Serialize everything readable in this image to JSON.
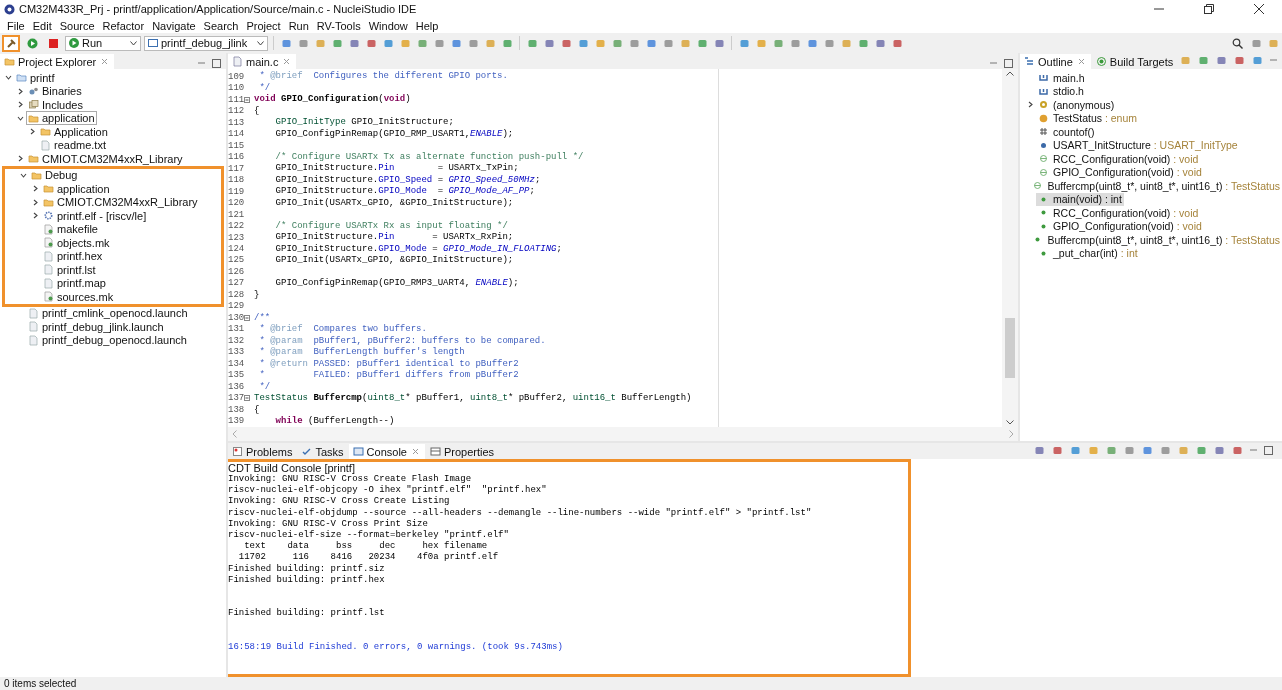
{
  "window": {
    "title": "CM32M433R_Prj - printf/application/Application/Source/main.c - NucleiStudio IDE"
  },
  "menu": [
    "File",
    "Edit",
    "Source",
    "Refactor",
    "Navigate",
    "Search",
    "Project",
    "Run",
    "RV-Tools",
    "Window",
    "Help"
  ],
  "toolbar": {
    "build_highlighted": true,
    "run_mode": "Run",
    "launch_config": "printf_debug_jlink"
  },
  "project_explorer": {
    "title": "Project Explorer",
    "tree": [
      {
        "label": "printf",
        "kind": "project",
        "expanded": true,
        "selected": false,
        "children": [
          {
            "label": "Binaries",
            "kind": "binaries",
            "expanded": false,
            "selected": false
          },
          {
            "label": "Includes",
            "kind": "includes",
            "expanded": false,
            "selected": false
          },
          {
            "label": "application",
            "kind": "folder",
            "expanded": true,
            "selected": true,
            "children": [
              {
                "label": "Application",
                "kind": "folder",
                "expanded": false,
                "selected": false
              },
              {
                "label": "readme.txt",
                "kind": "file",
                "selected": false
              }
            ]
          },
          {
            "label": "CMIOT.CM32M4xxR_Library",
            "kind": "folder",
            "expanded": false,
            "selected": false
          },
          {
            "label": "Debug",
            "kind": "folder",
            "expanded": true,
            "selected": false,
            "highlighted": true,
            "children": [
              {
                "label": "application",
                "kind": "folder",
                "expanded": false,
                "selected": false
              },
              {
                "label": "CMIOT.CM32M4xxR_Library",
                "kind": "folder",
                "expanded": false,
                "selected": false
              },
              {
                "label": "printf.elf - [riscv/le]",
                "kind": "elf",
                "expanded": false,
                "selected": false
              },
              {
                "label": "makefile",
                "kind": "makefile",
                "selected": false
              },
              {
                "label": "objects.mk",
                "kind": "makefile",
                "selected": false
              },
              {
                "label": "printf.hex",
                "kind": "file",
                "selected": false
              },
              {
                "label": "printf.lst",
                "kind": "file",
                "selected": false
              },
              {
                "label": "printf.map",
                "kind": "file",
                "selected": false
              },
              {
                "label": "sources.mk",
                "kind": "makefile",
                "selected": false
              }
            ]
          },
          {
            "label": "printf_cmlink_openocd.launch",
            "kind": "file",
            "selected": false
          },
          {
            "label": "printf_debug_jlink.launch",
            "kind": "file",
            "selected": false
          },
          {
            "label": "printf_debug_openocd.launch",
            "kind": "file",
            "selected": false
          }
        ]
      }
    ]
  },
  "editor": {
    "tab": "main.c",
    "lines": [
      {
        "no": "109",
        "tokens": [
          {
            "t": " * ",
            "kind": "doc"
          },
          {
            "t": "@brief",
            "kind": "tag"
          },
          {
            "t": "  Configures the different GPIO ports.",
            "kind": "doc"
          }
        ]
      },
      {
        "no": "110",
        "tokens": [
          {
            "t": " */",
            "kind": "doc"
          }
        ]
      },
      {
        "no": "111",
        "fold": true,
        "tokens": [
          {
            "t": "void",
            "kind": "kw"
          },
          {
            "t": " GPIO_Configuration",
            "kind": "fn"
          },
          {
            "t": "(",
            "kind": "plain"
          },
          {
            "t": "void",
            "kind": "kw"
          },
          {
            "t": ")",
            "kind": "plain"
          }
        ]
      },
      {
        "no": "112",
        "tokens": [
          {
            "t": "{",
            "kind": "plain"
          }
        ]
      },
      {
        "no": "113",
        "tokens": [
          {
            "t": "    GPIO_InitType",
            "kind": "type"
          },
          {
            "t": " GPIO_InitStructure;",
            "kind": "plain"
          }
        ]
      },
      {
        "no": "114",
        "tokens": [
          {
            "t": "    GPIO_ConfigPinRemap(GPIO_RMP_USART1,",
            "kind": "plain"
          },
          {
            "t": "ENABLE",
            "kind": "const"
          },
          {
            "t": ");",
            "kind": "plain"
          }
        ]
      },
      {
        "no": "115"
      },
      {
        "no": "116",
        "tokens": [
          {
            "t": "    /* Configure USARTx Tx as alternate function push-pull */",
            "kind": "comment"
          }
        ]
      },
      {
        "no": "117",
        "tokens": [
          {
            "t": "    GPIO_InitStructure.",
            "kind": "plain"
          },
          {
            "t": "Pin",
            "kind": "field"
          },
          {
            "t": "        = USARTx_TxPin;",
            "kind": "plain"
          }
        ]
      },
      {
        "no": "118",
        "tokens": [
          {
            "t": "    GPIO_InitStructure.",
            "kind": "plain"
          },
          {
            "t": "GPIO_Speed",
            "kind": "field"
          },
          {
            "t": " = ",
            "kind": "plain"
          },
          {
            "t": "GPIO_Speed_50MHz",
            "kind": "const"
          },
          {
            "t": ";",
            "kind": "plain"
          }
        ]
      },
      {
        "no": "119",
        "tokens": [
          {
            "t": "    GPIO_InitStructure.",
            "kind": "plain"
          },
          {
            "t": "GPIO_Mode",
            "kind": "field"
          },
          {
            "t": "  = ",
            "kind": "plain"
          },
          {
            "t": "GPIO_Mode_AF_PP",
            "kind": "const"
          },
          {
            "t": ";",
            "kind": "plain"
          }
        ]
      },
      {
        "no": "120",
        "tokens": [
          {
            "t": "    GPIO_Init(USARTx_GPIO, &GPIO_InitStructure);",
            "kind": "plain"
          }
        ]
      },
      {
        "no": "121"
      },
      {
        "no": "122",
        "tokens": [
          {
            "t": "    /* Configure USARTx Rx as input floating */",
            "kind": "comment"
          }
        ]
      },
      {
        "no": "123",
        "tokens": [
          {
            "t": "    GPIO_InitStructure.",
            "kind": "plain"
          },
          {
            "t": "Pin",
            "kind": "field"
          },
          {
            "t": "       = USARTx_RxPin;",
            "kind": "plain"
          }
        ]
      },
      {
        "no": "124",
        "tokens": [
          {
            "t": "    GPIO_InitStructure.",
            "kind": "plain"
          },
          {
            "t": "GPIO_Mode",
            "kind": "field"
          },
          {
            "t": " = ",
            "kind": "plain"
          },
          {
            "t": "GPIO_Mode_IN_FLOATING",
            "kind": "const"
          },
          {
            "t": ";",
            "kind": "plain"
          }
        ]
      },
      {
        "no": "125",
        "tokens": [
          {
            "t": "    GPIO_Init(USARTx_GPIO, &GPIO_InitStructure);",
            "kind": "plain"
          }
        ]
      },
      {
        "no": "126"
      },
      {
        "no": "127",
        "tokens": [
          {
            "t": "    GPIO_ConfigPinRemap(GPIO_RMP3_UART4, ",
            "kind": "plain"
          },
          {
            "t": "ENABLE",
            "kind": "const"
          },
          {
            "t": ");",
            "kind": "plain"
          }
        ]
      },
      {
        "no": "128",
        "tokens": [
          {
            "t": "}",
            "kind": "plain"
          }
        ]
      },
      {
        "no": "129"
      },
      {
        "no": "130",
        "fold": true,
        "tokens": [
          {
            "t": "/**",
            "kind": "doc"
          }
        ]
      },
      {
        "no": "131",
        "tokens": [
          {
            "t": " * ",
            "kind": "doc"
          },
          {
            "t": "@brief",
            "kind": "tag"
          },
          {
            "t": "  Compares two buffers.",
            "kind": "doc"
          }
        ]
      },
      {
        "no": "132",
        "tokens": [
          {
            "t": " * ",
            "kind": "doc"
          },
          {
            "t": "@param",
            "kind": "tag"
          },
          {
            "t": "  pBuffer1, pBuffer2: buffers to be compared.",
            "kind": "doc"
          }
        ]
      },
      {
        "no": "133",
        "tokens": [
          {
            "t": " * ",
            "kind": "doc"
          },
          {
            "t": "@param",
            "kind": "tag"
          },
          {
            "t": "  BufferLength buffer's length",
            "kind": "doc"
          }
        ]
      },
      {
        "no": "134",
        "tokens": [
          {
            "t": " * ",
            "kind": "doc"
          },
          {
            "t": "@return",
            "kind": "tag"
          },
          {
            "t": " PASSED: pBuffer1 identical to pBuffer2",
            "kind": "doc"
          }
        ]
      },
      {
        "no": "135",
        "tokens": [
          {
            "t": " *         FAILED: pBuffer1 differs from pBuffer2",
            "kind": "doc"
          }
        ]
      },
      {
        "no": "136",
        "tokens": [
          {
            "t": " */",
            "kind": "doc"
          }
        ]
      },
      {
        "no": "137",
        "fold": true,
        "tokens": [
          {
            "t": "TestStatus",
            "kind": "type"
          },
          {
            "t": " Buffercmp",
            "kind": "fn"
          },
          {
            "t": "(",
            "kind": "plain"
          },
          {
            "t": "uint8_t",
            "kind": "type"
          },
          {
            "t": "* pBuffer1, ",
            "kind": "plain"
          },
          {
            "t": "uint8_t",
            "kind": "type"
          },
          {
            "t": "* pBuffer2, ",
            "kind": "plain"
          },
          {
            "t": "uint16_t",
            "kind": "type"
          },
          {
            "t": " BufferLength)",
            "kind": "plain"
          }
        ]
      },
      {
        "no": "138",
        "tokens": [
          {
            "t": "{",
            "kind": "plain"
          }
        ]
      },
      {
        "no": "139",
        "tokens": [
          {
            "t": "    while",
            "kind": "kw"
          },
          {
            "t": " (BufferLength--)",
            "kind": "plain"
          }
        ]
      }
    ]
  },
  "outline": {
    "tabs": [
      {
        "label": "Outline",
        "selected": true
      },
      {
        "label": "Build Targets",
        "selected": false
      }
    ],
    "items": [
      {
        "kind": "include",
        "label": "main.h",
        "selected": false
      },
      {
        "kind": "include",
        "label": "stdio.h",
        "selected": false
      },
      {
        "kind": "struct",
        "label": "(anonymous)",
        "expanded": false,
        "selected": false
      },
      {
        "kind": "enum",
        "label": "TestStatus",
        "type": " : enum",
        "selected": false
      },
      {
        "kind": "macro",
        "label": "countof()",
        "selected": false
      },
      {
        "kind": "variable",
        "label": "USART_InitStructure",
        "type": " : USART_InitType",
        "selected": false
      },
      {
        "kind": "declaration",
        "label": "RCC_Configuration(void)",
        "type": " : void",
        "selected": false
      },
      {
        "kind": "declaration",
        "label": "GPIO_Configuration(void)",
        "type": " : void",
        "selected": false
      },
      {
        "kind": "declaration",
        "label": "Buffercmp(uint8_t*, uint8_t*, uint16_t)",
        "type": " : TestStatus",
        "selected": false
      },
      {
        "kind": "function",
        "label": "main(void) : int",
        "selected": true
      },
      {
        "kind": "function",
        "label": "RCC_Configuration(void)",
        "type": " : void",
        "selected": false
      },
      {
        "kind": "function",
        "label": "GPIO_Configuration(void)",
        "type": " : void",
        "selected": false
      },
      {
        "kind": "function",
        "label": "Buffercmp(uint8_t*, uint8_t*, uint16_t)",
        "type": " : TestStatus",
        "selected": false
      },
      {
        "kind": "function",
        "label": "_put_char(int)",
        "type": " : int",
        "selected": false
      }
    ]
  },
  "bottom_panel": {
    "tabs": [
      {
        "label": "Problems",
        "kind": "problems",
        "selected": false
      },
      {
        "label": "Tasks",
        "kind": "tasks",
        "selected": false
      },
      {
        "label": "Console",
        "kind": "console",
        "selected": true
      },
      {
        "label": "Properties",
        "kind": "properties",
        "selected": false
      }
    ],
    "console": {
      "title": "CDT Build Console [printf]",
      "highlighted": true,
      "lines": [
        {
          "kind": "output",
          "text": "Invoking: GNU RISC-V Cross Create Flash Image"
        },
        {
          "kind": "output",
          "text": "riscv-nuclei-elf-objcopy -O ihex \"printf.elf\"  \"printf.hex\""
        },
        {
          "kind": "output",
          "text": "Invoking: GNU RISC-V Cross Create Listing"
        },
        {
          "kind": "output",
          "text": "riscv-nuclei-elf-objdump --source --all-headers --demangle --line-numbers --wide \"printf.elf\" > \"printf.lst\""
        },
        {
          "kind": "output",
          "text": "Invoking: GNU RISC-V Cross Print Size"
        },
        {
          "kind": "output",
          "text": "riscv-nuclei-elf-size --format=berkeley \"printf.elf\""
        },
        {
          "kind": "output",
          "text": "   text\t   data\t    bss\t    dec\t    hex\tfilename"
        },
        {
          "kind": "output",
          "text": "  11702\t    116\t   8416\t  20234\t   4f0a\tprintf.elf"
        },
        {
          "kind": "output",
          "text": "Finished building: printf.siz"
        },
        {
          "kind": "output",
          "text": "Finished building: printf.hex"
        },
        {
          "kind": "blank"
        },
        {
          "kind": "blank"
        },
        {
          "kind": "output",
          "text": "Finished building: printf.lst"
        },
        {
          "kind": "blank"
        },
        {
          "kind": "blank"
        },
        {
          "kind": "status",
          "text": "16:58:19 Build Finished. 0 errors, 0 warnings. (took 9s.743ms)"
        }
      ]
    }
  },
  "status_bar": {
    "text": "0 items selected"
  }
}
